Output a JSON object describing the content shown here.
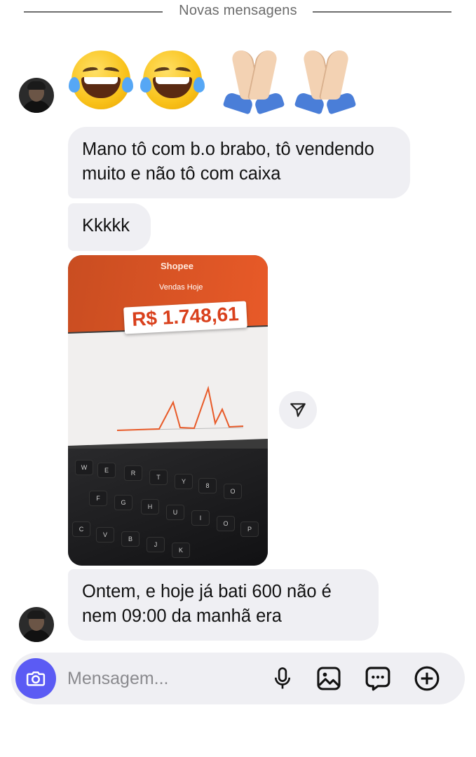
{
  "divider": {
    "label": "Novas mensagens"
  },
  "messages": {
    "emoji_row": [
      "face-with-tears-of-joy",
      "face-with-tears-of-joy",
      "folded-hands",
      "folded-hands"
    ],
    "text_1": "Mano tô com b.o brabo, tô vendendo muito e não tô com caixa",
    "text_2": "Kkkkk",
    "text_3": "Ontem, e hoje já bati 600 não é nem 09:00 da manhã era",
    "photo": {
      "brand": "Shopee",
      "title": "Vendas Hoje",
      "total": "R$ 1.748,61"
    }
  },
  "composer": {
    "placeholder": "Mensagem...",
    "icons": [
      "camera-icon",
      "microphone-icon",
      "image-icon",
      "sticker-icon",
      "plus-icon"
    ]
  },
  "colors": {
    "accent": "#5b5bf4",
    "bubble": "#efeff3",
    "shopee_orange": "#e85a28"
  }
}
